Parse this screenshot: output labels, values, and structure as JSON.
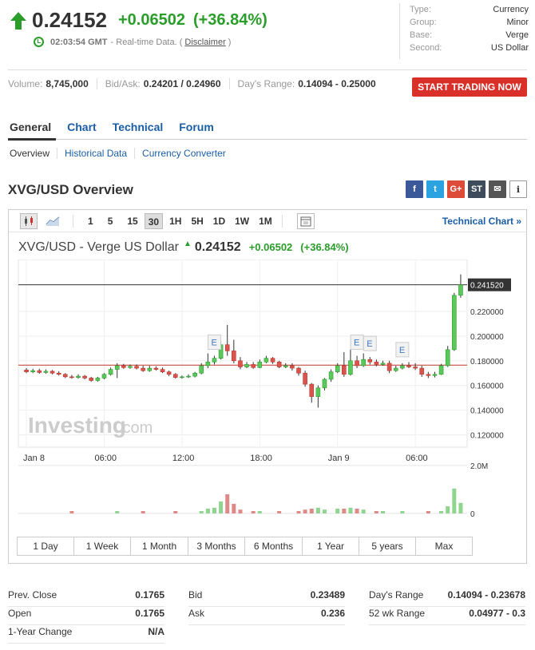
{
  "quote": {
    "price": "0.24152",
    "change": "+0.06502",
    "change_pct": "(+36.84%)",
    "time": "02:03:54 GMT",
    "time_note": "- Real-time Data. (",
    "disclaimer": "Disclaimer",
    "time_close": ")"
  },
  "meta": [
    {
      "k": "Type:",
      "v": "Currency"
    },
    {
      "k": "Group:",
      "v": "Minor"
    },
    {
      "k": "Base:",
      "v": "Verge"
    },
    {
      "k": "Second:",
      "v": "US Dollar"
    }
  ],
  "stats": {
    "volume_label": "Volume:",
    "volume": "8,745,000",
    "bidask_label": "Bid/Ask:",
    "bidask": "0.24201 / 0.24960",
    "range_label": "Day's Range:",
    "range": "0.14094 - 0.25000"
  },
  "trade_button": "START TRADING NOW",
  "tabs": [
    "General",
    "Chart",
    "Technical",
    "Forum"
  ],
  "subtabs": [
    "Overview",
    "Historical Data",
    "Currency Converter"
  ],
  "overview_title": "XVG/USD Overview",
  "social": {
    "fb": "f",
    "tw": "t",
    "gp": "G+",
    "st": "ST",
    "em": "✉",
    "info": "i"
  },
  "toolbar": {
    "intervals": [
      "1",
      "5",
      "15",
      "30",
      "1H",
      "5H",
      "1D",
      "1W",
      "1M"
    ],
    "selected": "30",
    "technical_link": "Technical Chart »"
  },
  "chart_header": {
    "name": "XVG/USD - Verge US Dollar",
    "arrow": "▲",
    "price": "0.24152",
    "change": "+0.06502",
    "change_pct": "(+36.84%)"
  },
  "chart_data": {
    "type": "candlestick",
    "x_ticks": [
      "Jan 8",
      "06:00",
      "12:00",
      "18:00",
      "Jan 9",
      "06:00"
    ],
    "y_ticks": [
      "0.220000",
      "0.200000",
      "0.180000",
      "0.160000",
      "0.140000",
      "0.120000"
    ],
    "ylim": [
      0.11,
      0.262
    ],
    "last_price_label": "0.241520",
    "last_price": 0.24152,
    "prev_close": 0.1765,
    "volume_ticks": [
      "2.0M",
      "0"
    ],
    "volume_max": 2000000,
    "event_marker": "E",
    "watermark": "Investing",
    "watermark_suffix": ".com",
    "candles": [
      [
        0.1725,
        0.171,
        0.174,
        0.17
      ],
      [
        0.171,
        0.172,
        0.1735,
        0.17
      ],
      [
        0.172,
        0.1705,
        0.1735,
        0.1695
      ],
      [
        0.1705,
        0.1715,
        0.173,
        0.1695
      ],
      [
        0.1715,
        0.17,
        0.1725,
        0.169
      ],
      [
        0.17,
        0.169,
        0.1715,
        0.168
      ],
      [
        0.169,
        0.167,
        0.17,
        0.166
      ],
      [
        0.167,
        0.1665,
        0.1685,
        0.1655
      ],
      [
        0.1665,
        0.1675,
        0.169,
        0.1655
      ],
      [
        0.1675,
        0.166,
        0.1685,
        0.165
      ],
      [
        0.166,
        0.164,
        0.167,
        0.163
      ],
      [
        0.164,
        0.166,
        0.167,
        0.163
      ],
      [
        0.166,
        0.169,
        0.17,
        0.165
      ],
      [
        0.169,
        0.173,
        0.1745,
        0.168
      ],
      [
        0.173,
        0.176,
        0.178,
        0.166
      ],
      [
        0.176,
        0.1745,
        0.1775,
        0.1735
      ],
      [
        0.1745,
        0.1755,
        0.177,
        0.1735
      ],
      [
        0.1755,
        0.174,
        0.177,
        0.173
      ],
      [
        0.174,
        0.172,
        0.176,
        0.171
      ],
      [
        0.172,
        0.174,
        0.176,
        0.171
      ],
      [
        0.174,
        0.173,
        0.1755,
        0.172
      ],
      [
        0.173,
        0.171,
        0.1745,
        0.17
      ],
      [
        0.171,
        0.169,
        0.172,
        0.1675
      ],
      [
        0.169,
        0.1665,
        0.17,
        0.1655
      ],
      [
        0.1665,
        0.167,
        0.168,
        0.1655
      ],
      [
        0.167,
        0.1675,
        0.169,
        0.166
      ],
      [
        0.1675,
        0.17,
        0.171,
        0.1665
      ],
      [
        0.17,
        0.176,
        0.178,
        0.169
      ],
      [
        0.176,
        0.179,
        0.186,
        0.174
      ],
      [
        0.179,
        0.182,
        0.184,
        0.177
      ],
      [
        0.182,
        0.193,
        0.196,
        0.181
      ],
      [
        0.193,
        0.188,
        0.209,
        0.184
      ],
      [
        0.188,
        0.18,
        0.197,
        0.178
      ],
      [
        0.18,
        0.175,
        0.183,
        0.173
      ],
      [
        0.175,
        0.177,
        0.179,
        0.174
      ],
      [
        0.177,
        0.1745,
        0.179,
        0.1735
      ],
      [
        0.1745,
        0.179,
        0.181,
        0.174
      ],
      [
        0.179,
        0.182,
        0.184,
        0.178
      ],
      [
        0.182,
        0.179,
        0.183,
        0.1775
      ],
      [
        0.179,
        0.175,
        0.18,
        0.174
      ],
      [
        0.175,
        0.176,
        0.178,
        0.174
      ],
      [
        0.176,
        0.174,
        0.178,
        0.172
      ],
      [
        0.174,
        0.17,
        0.175,
        0.168
      ],
      [
        0.17,
        0.161,
        0.172,
        0.159
      ],
      [
        0.161,
        0.151,
        0.162,
        0.146
      ],
      [
        0.151,
        0.158,
        0.16,
        0.142
      ],
      [
        0.158,
        0.165,
        0.166,
        0.156
      ],
      [
        0.165,
        0.171,
        0.173,
        0.163
      ],
      [
        0.171,
        0.176,
        0.178,
        0.17
      ],
      [
        0.176,
        0.169,
        0.187,
        0.167
      ],
      [
        0.169,
        0.18,
        0.189,
        0.168
      ],
      [
        0.18,
        0.176,
        0.184,
        0.174
      ],
      [
        0.176,
        0.181,
        0.186,
        0.175
      ],
      [
        0.181,
        0.179,
        0.183,
        0.177
      ],
      [
        0.179,
        0.177,
        0.181,
        0.1755
      ],
      [
        0.177,
        0.178,
        0.18,
        0.176
      ],
      [
        0.178,
        0.172,
        0.18,
        0.17
      ],
      [
        0.172,
        0.174,
        0.176,
        0.171
      ],
      [
        0.174,
        0.176,
        0.178,
        0.173
      ],
      [
        0.176,
        0.175,
        0.179,
        0.174
      ],
      [
        0.175,
        0.174,
        0.178,
        0.1725
      ],
      [
        0.174,
        0.169,
        0.176,
        0.167
      ],
      [
        0.169,
        0.168,
        0.171,
        0.166
      ],
      [
        0.168,
        0.169,
        0.171,
        0.1665
      ],
      [
        0.169,
        0.176,
        0.1775,
        0.1685
      ],
      [
        0.176,
        0.189,
        0.192,
        0.175
      ],
      [
        0.189,
        0.233,
        0.235,
        0.188
      ],
      [
        0.233,
        0.2415,
        0.25,
        0.231
      ]
    ],
    "event_candles": [
      29,
      51,
      53,
      58
    ],
    "volumes": [
      0,
      0,
      0,
      0,
      0,
      0,
      0,
      0.05,
      0,
      0,
      0,
      0,
      0,
      0,
      0.05,
      0,
      0,
      0,
      0.05,
      0,
      0,
      0,
      0,
      0.05,
      0,
      0,
      0,
      0.05,
      0.1,
      0.12,
      0.25,
      0.4,
      0.2,
      0.08,
      0,
      0.05,
      0.05,
      0,
      0,
      0.05,
      0,
      0,
      0.05,
      0.08,
      0.1,
      0.12,
      0.08,
      0,
      0.1,
      0.1,
      0.12,
      0.1,
      0.08,
      0,
      0.05,
      0.05,
      0,
      0,
      0.05,
      0,
      0,
      0,
      0.05,
      0,
      0.05,
      0.15,
      0.52,
      0.22
    ]
  },
  "ranges": [
    "1 Day",
    "1 Week",
    "1 Month",
    "3 Months",
    "6 Months",
    "1 Year",
    "5 years",
    "Max"
  ],
  "bottom_stats": {
    "col1": [
      {
        "k": "Prev. Close",
        "v": "0.1765"
      },
      {
        "k": "Open",
        "v": "0.1765"
      },
      {
        "k": "1-Year Change",
        "v": "N/A"
      }
    ],
    "col2": [
      {
        "k": "Bid",
        "v": "0.23489"
      },
      {
        "k": "Ask",
        "v": "0.236"
      }
    ],
    "col3": [
      {
        "k": "Day's Range",
        "v": "0.14094 - 0.23678"
      },
      {
        "k": "52 wk Range",
        "v": "0.04977 - 0.3"
      }
    ]
  }
}
